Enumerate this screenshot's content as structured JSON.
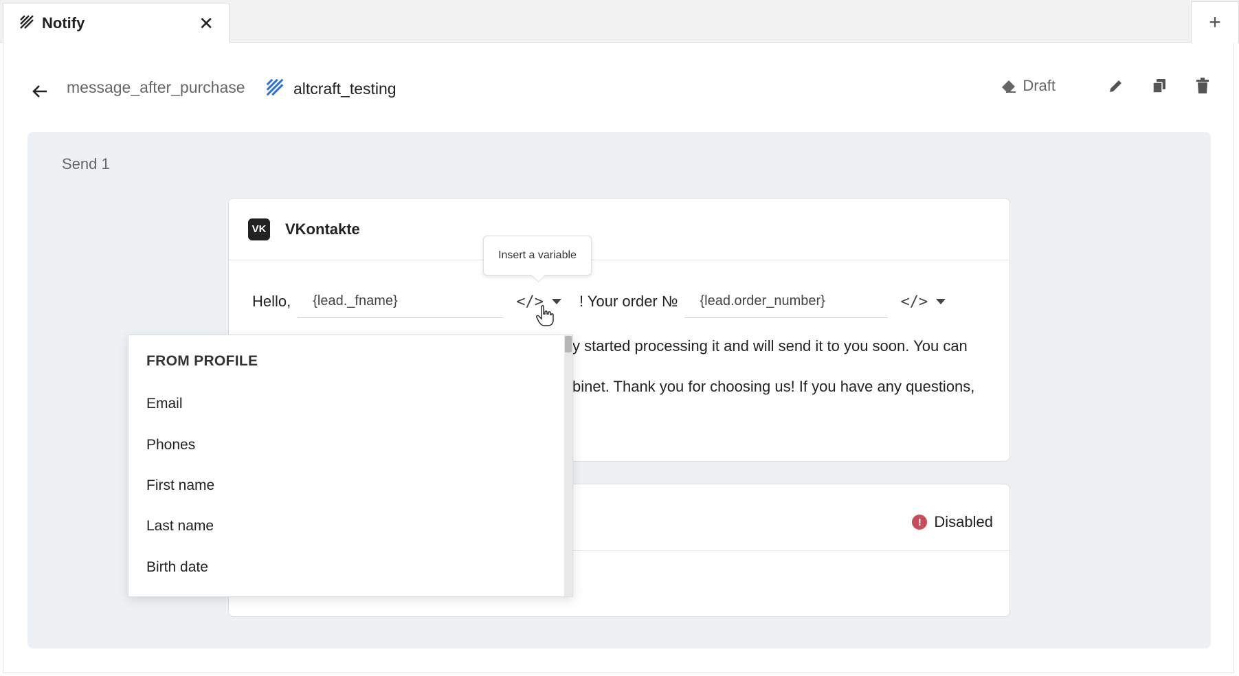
{
  "tab": {
    "title": "Notify",
    "close": "✕",
    "new_tab": "+"
  },
  "header": {
    "back_icon": "arrow-left-icon",
    "message_name": "message_after_purchase",
    "account_name": "altcraft_testing",
    "status": "Draft"
  },
  "panel": {
    "title": "Send 1"
  },
  "channel": {
    "logo_text": "VK",
    "name": "VKontakte",
    "greeting": "Hello,",
    "var1": "{lead._fname}",
    "code_label": "</>",
    "order_label": "! Your order №",
    "var2": "{lead.order_number}",
    "text_line1": "y started processing it and will send it to you soon. You can",
    "text_line2": "binet. Thank you for choosing us! If you have any questions,"
  },
  "tooltip": "Insert a variable",
  "second_card": {
    "status_icon": "!",
    "status": "Disabled"
  },
  "dropdown": {
    "header": "FROM PROFILE",
    "items": [
      "Email",
      "Phones",
      "First name",
      "Last name",
      "Birth date"
    ]
  },
  "colors": {
    "panel_bg": "#eef1f4",
    "disabled_badge": "#c94c5a",
    "logo_blue": "#2a6fd6"
  }
}
